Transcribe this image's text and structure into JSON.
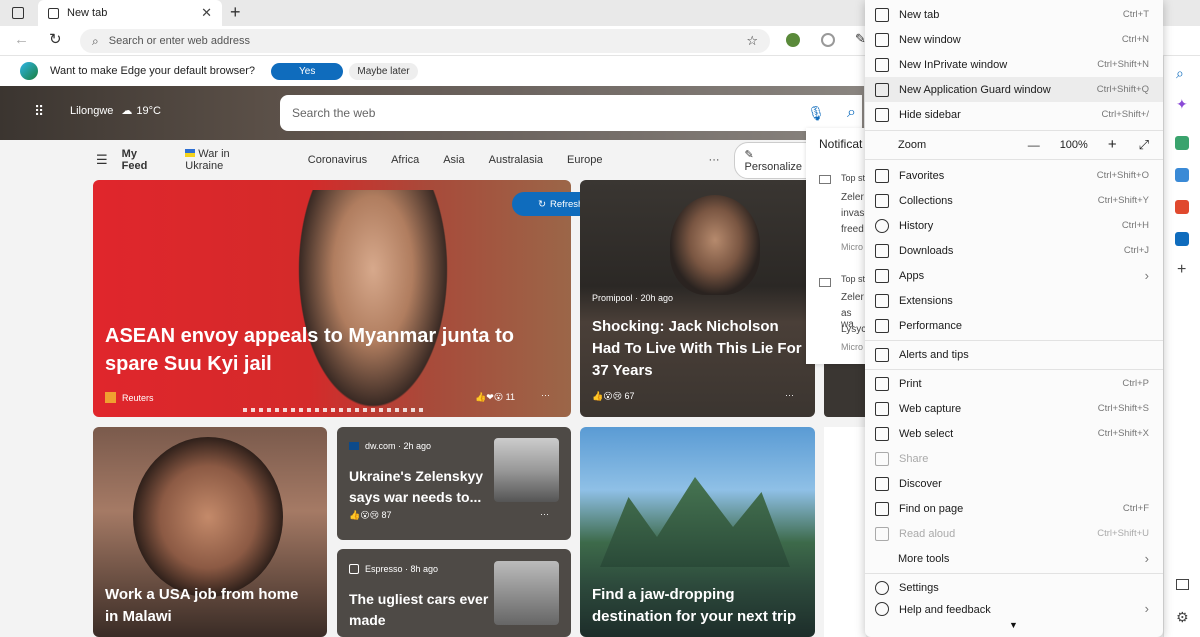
{
  "tab": {
    "title": "New tab"
  },
  "address": {
    "placeholder": "Search or enter web address"
  },
  "infobar": {
    "message": "Want to make Edge your default browser?",
    "yes": "Yes",
    "later": "Maybe later"
  },
  "weather": {
    "location": "Lilongwe",
    "temp": "19°C"
  },
  "search": {
    "placeholder": "Search the web"
  },
  "feed": {
    "items": [
      "My Feed",
      "War in Ukraine",
      "Coronavirus",
      "Africa",
      "Asia",
      "Australasia",
      "Europe"
    ],
    "more": "···",
    "personalize": "Personalize",
    "refresh": "Refresh stories"
  },
  "cards": {
    "c1": {
      "title": "ASEAN envoy appeals to Myanmar junta to spare Suu Kyi jail",
      "source": "Reuters",
      "reactions": "11"
    },
    "c2": {
      "source": "Promipool · 20h ago",
      "title": "Shocking: Jack Nicholson Had To Live With This Lie For 37 Years",
      "reactions": "67"
    },
    "c3": {
      "title": "Work a USA job from home in Malawi"
    },
    "c4": {
      "source": "dw.com · 2h ago",
      "title": "Ukraine's Zelenskyy says war needs to...",
      "reactions": "87"
    },
    "c5": {
      "source": "Espresso · 8h ago",
      "title": "The ugliest cars ever made"
    },
    "c6": {
      "title": "Find a jaw-dropping destination for your next trip"
    }
  },
  "notif": {
    "title": "Notificat",
    "t1": "Top st",
    "l1": "Zeler",
    "l2": "invas",
    "l3": "freed",
    "m1": "Micro",
    "t2": "Top st",
    "l4": "Zeler",
    "l5": "as wa",
    "l6": "Lysyc",
    "m2": "Micro"
  },
  "menu": {
    "new_tab": {
      "label": "New tab",
      "sc": "Ctrl+T"
    },
    "new_window": {
      "label": "New window",
      "sc": "Ctrl+N"
    },
    "inprivate": {
      "label": "New InPrivate window",
      "sc": "Ctrl+Shift+N"
    },
    "guard": {
      "label": "New Application Guard window",
      "sc": "Ctrl+Shift+Q"
    },
    "hide_sidebar": {
      "label": "Hide sidebar",
      "sc": "Ctrl+Shift+/"
    },
    "zoom": {
      "label": "Zoom",
      "minus": "—",
      "value": "100%",
      "plus": "+"
    },
    "favorites": {
      "label": "Favorites",
      "sc": "Ctrl+Shift+O"
    },
    "collections": {
      "label": "Collections",
      "sc": "Ctrl+Shift+Y"
    },
    "history": {
      "label": "History",
      "sc": "Ctrl+H"
    },
    "downloads": {
      "label": "Downloads",
      "sc": "Ctrl+J"
    },
    "apps": {
      "label": "Apps",
      "sc": "›"
    },
    "extensions": {
      "label": "Extensions",
      "sc": ""
    },
    "performance": {
      "label": "Performance",
      "sc": ""
    },
    "alerts": {
      "label": "Alerts and tips",
      "sc": ""
    },
    "print": {
      "label": "Print",
      "sc": "Ctrl+P"
    },
    "web_capture": {
      "label": "Web capture",
      "sc": "Ctrl+Shift+S"
    },
    "web_select": {
      "label": "Web select",
      "sc": "Ctrl+Shift+X"
    },
    "share": {
      "label": "Share",
      "sc": ""
    },
    "discover": {
      "label": "Discover",
      "sc": ""
    },
    "find": {
      "label": "Find on page",
      "sc": "Ctrl+F"
    },
    "read_aloud": {
      "label": "Read aloud",
      "sc": "Ctrl+Shift+U"
    },
    "more_tools": {
      "label": "More tools",
      "sc": "›"
    },
    "settings": {
      "label": "Settings",
      "sc": ""
    },
    "help": {
      "label": "Help and feedback",
      "sc": "›"
    }
  },
  "colors": {
    "accent": "#0f6cbd",
    "hero_card": "#d9262c"
  }
}
